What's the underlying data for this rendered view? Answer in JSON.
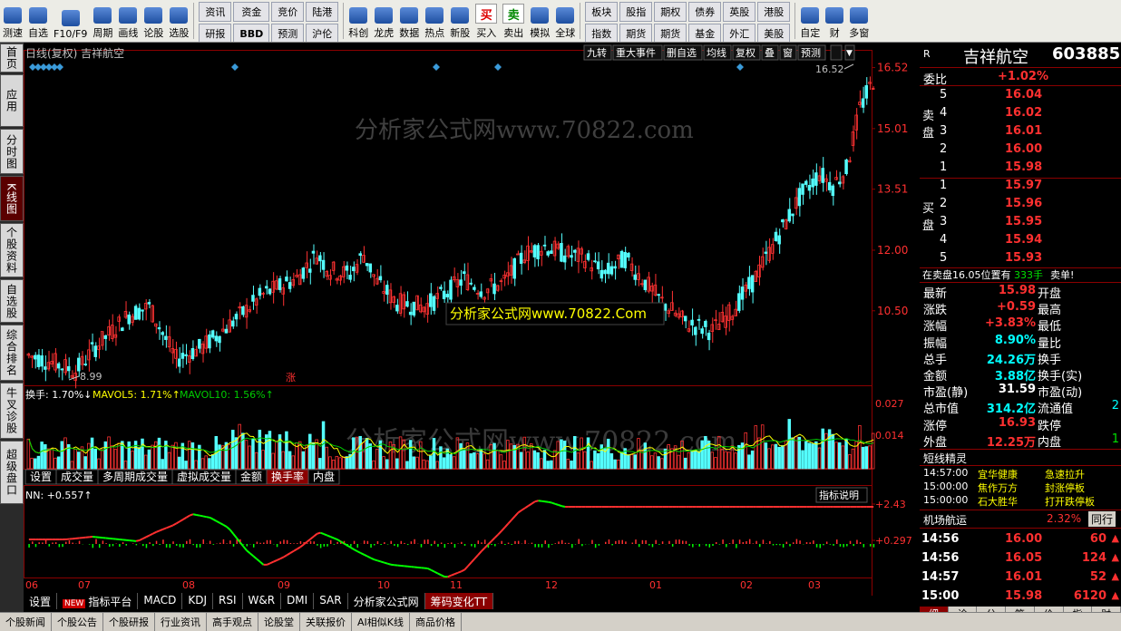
{
  "toolbar": {
    "left_buttons": [
      {
        "name": "test-button",
        "label": "测速",
        "icon": "speed-icon"
      },
      {
        "name": "selfselect-button",
        "label": "自选",
        "icon": "star-icon"
      },
      {
        "name": "f10-button",
        "label": "F10/F9",
        "icon": "f10-icon"
      },
      {
        "name": "period-button",
        "label": "周期",
        "icon": "clock-icon"
      },
      {
        "name": "draw-button",
        "label": "画线",
        "icon": "pencil-icon"
      },
      {
        "name": "stockforum-button",
        "label": "论股",
        "icon": "forum-icon"
      },
      {
        "name": "selectstock-button",
        "label": "选股",
        "icon": "magnifier-icon"
      }
    ],
    "grid1": [
      [
        "资讯",
        "研报"
      ],
      [
        "资金",
        "BBD"
      ],
      [
        "竞价",
        "预测"
      ],
      [
        "陆港",
        "沪伦"
      ]
    ],
    "mid_buttons": [
      {
        "name": "kechuang-button",
        "label": "科创",
        "icon": "chart-icon"
      },
      {
        "name": "dragontiger-button",
        "label": "龙虎",
        "icon": "dragon-icon"
      },
      {
        "name": "data-button",
        "label": "数据",
        "icon": "pe-icon"
      },
      {
        "name": "hotspot-button",
        "label": "热点",
        "icon": "fire-icon"
      },
      {
        "name": "ipo-button",
        "label": "新股",
        "icon": "ipo-icon"
      },
      {
        "name": "buy-button",
        "label": "买入",
        "icon": "buy-icon",
        "glyph": "买"
      },
      {
        "name": "sell-button",
        "label": "卖出",
        "icon": "sell-icon",
        "glyph": "卖"
      },
      {
        "name": "simulate-button",
        "label": "模拟",
        "icon": "hammer-icon"
      },
      {
        "name": "global-button",
        "label": "全球",
        "icon": "globe-icon"
      }
    ],
    "grid2": [
      [
        "板块",
        "指数"
      ],
      [
        "股指",
        "期货"
      ],
      [
        "期权",
        "期货"
      ],
      [
        "债券",
        "基金"
      ],
      [
        "英股",
        "外汇"
      ],
      [
        "港股",
        "美股"
      ]
    ],
    "right_buttons": [
      {
        "name": "custom-button",
        "label": "自定",
        "icon": "edit-icon"
      },
      {
        "name": "finance-button",
        "label": "财",
        "icon": "money-icon"
      },
      {
        "name": "multi-button",
        "label": "多窗",
        "icon": "window-icon"
      }
    ]
  },
  "leftnav": [
    {
      "label": "首页",
      "active": false
    },
    {
      "label": "应用",
      "active": false
    },
    {
      "label": "分时图",
      "active": false
    },
    {
      "label": "K线图",
      "active": true
    },
    {
      "label": "个股资料",
      "active": false
    },
    {
      "label": "自选股",
      "active": false
    },
    {
      "label": "综合排名",
      "active": false
    },
    {
      "label": "牛叉诊股",
      "active": false
    },
    {
      "label": "超级盘口",
      "active": false
    }
  ],
  "chart": {
    "header": "日线(复权)  吉祥航空",
    "header_buttons": [
      "九转",
      "重大事件",
      "删自选",
      "均线",
      "复权",
      "叠",
      "窗",
      "预测"
    ],
    "max_label": "16.52",
    "min_label": "8.99",
    "price_axis": [
      "16.52",
      "15.01",
      "13.51",
      "12.00",
      "10.50"
    ],
    "limit_badge": "涨",
    "watermark1": "分析家公式网www.70822.com",
    "watermark2": "分析家公式网www.70822.Com",
    "watermark3": "分析家公式网www.70822.com",
    "vol_header": {
      "a": "换手: 1.70%↓",
      "b": "MAVOL5: 1.71%↑",
      "c": "MAVOL10: 1.56%↑"
    },
    "vol_axis": [
      "0.027",
      "0.014"
    ],
    "vol_tabs": [
      "设置",
      "成交量",
      "多周期成交量",
      "虚拟成交量",
      "金额",
      "换手率",
      "内盘"
    ],
    "vol_tab_active": "换手率",
    "nn_header": "NN: +0.557↑",
    "nn_btn": "指标说明",
    "nn_axis": [
      "+2.43",
      "+0.297"
    ],
    "months": [
      "06",
      "07",
      "08",
      "09",
      "10",
      "11",
      "12",
      "01",
      "02",
      "03"
    ],
    "colors": {
      "up": "#ff3232",
      "down": "#54ffff",
      "nn_up": "#ff3030",
      "nn_down": "#00ff00",
      "grid": "#8b0000"
    }
  },
  "bottom_tabs": [
    "设置",
    "指标平台",
    "MACD",
    "KDJ",
    "RSI",
    "W&R",
    "DMI",
    "SAR",
    "分析家公式网",
    "筹码变化TT"
  ],
  "bottom_new": "NEW",
  "bottom_tabs2": [
    "个股新闻",
    "个股公告",
    "个股研报",
    "行业资讯",
    "高手观点",
    "论股堂",
    "关联报价",
    "AI相似K线",
    "商品价格"
  ],
  "quote": {
    "mark": "R",
    "name": "吉祥航空",
    "code": "603885",
    "weibi_label": "委比",
    "weibi": "+1.02%",
    "sell_label": "卖盘",
    "buy_label": "买盘",
    "sells": [
      {
        "n": "5",
        "p": "16.04"
      },
      {
        "n": "4",
        "p": "16.02"
      },
      {
        "n": "3",
        "p": "16.01"
      },
      {
        "n": "2",
        "p": "16.00"
      },
      {
        "n": "1",
        "p": "15.98"
      }
    ],
    "buys": [
      {
        "n": "1",
        "p": "15.97"
      },
      {
        "n": "2",
        "p": "15.96"
      },
      {
        "n": "3",
        "p": "15.95"
      },
      {
        "n": "4",
        "p": "15.94"
      },
      {
        "n": "5",
        "p": "15.93"
      }
    ],
    "notice": {
      "a": "在卖盘",
      "b": "16.05",
      "c": "位置有",
      "d": "333手",
      "e": "卖单!"
    },
    "stats": [
      {
        "l": "最新",
        "v": "15.98",
        "r": "开盘",
        "c": "red"
      },
      {
        "l": "涨跌",
        "v": "+0.59",
        "r": "最高",
        "c": "red"
      },
      {
        "l": "涨幅",
        "v": "+3.83%",
        "r": "最低",
        "c": "red"
      },
      {
        "l": "振幅",
        "v": "8.90%",
        "r": "量比",
        "c": "cyn"
      },
      {
        "l": "总手",
        "v": "24.26万",
        "r": "换手",
        "c": "cyn"
      },
      {
        "l": "金额",
        "v": "3.88亿",
        "r": "换手(实)",
        "c": "cyn"
      },
      {
        "l": "市盈(静)",
        "v": "31.59",
        "r": "市盈(动)",
        "c": "wht"
      },
      {
        "l": "总市值",
        "v": "314.2亿",
        "r": "流通值",
        "c": "cyn",
        "rv": "2"
      },
      {
        "l": "涨停",
        "v": "16.93",
        "r": "跌停",
        "c": "red"
      },
      {
        "l": "外盘",
        "v": "12.25万",
        "r": "内盘",
        "c": "red",
        "rv": "1"
      }
    ],
    "spirit_title": "短线精灵",
    "spirit": [
      {
        "t": "14:57:00",
        "s": "宜华健康",
        "e": "急速拉升"
      },
      {
        "t": "15:00:00",
        "s": "焦作万方",
        "e": "封涨停板"
      },
      {
        "t": "15:00:00",
        "s": "石大胜华",
        "e": "打开跌停板"
      }
    ],
    "sector": {
      "name": "机场航运",
      "pct": "2.32%",
      "btn": "同行"
    },
    "ticks": [
      {
        "t": "14:56",
        "p": "16.00",
        "v": "60",
        "d": "up"
      },
      {
        "t": "14:56",
        "p": "16.05",
        "v": "124",
        "d": "up"
      },
      {
        "t": "14:57",
        "p": "16.01",
        "v": "52",
        "d": "up"
      },
      {
        "t": "15:00",
        "p": "15.98",
        "v": "6120",
        "d": "up"
      }
    ],
    "bottom_tabs": [
      "细",
      "诊",
      "分",
      "笔",
      "价",
      "指",
      "财"
    ]
  }
}
